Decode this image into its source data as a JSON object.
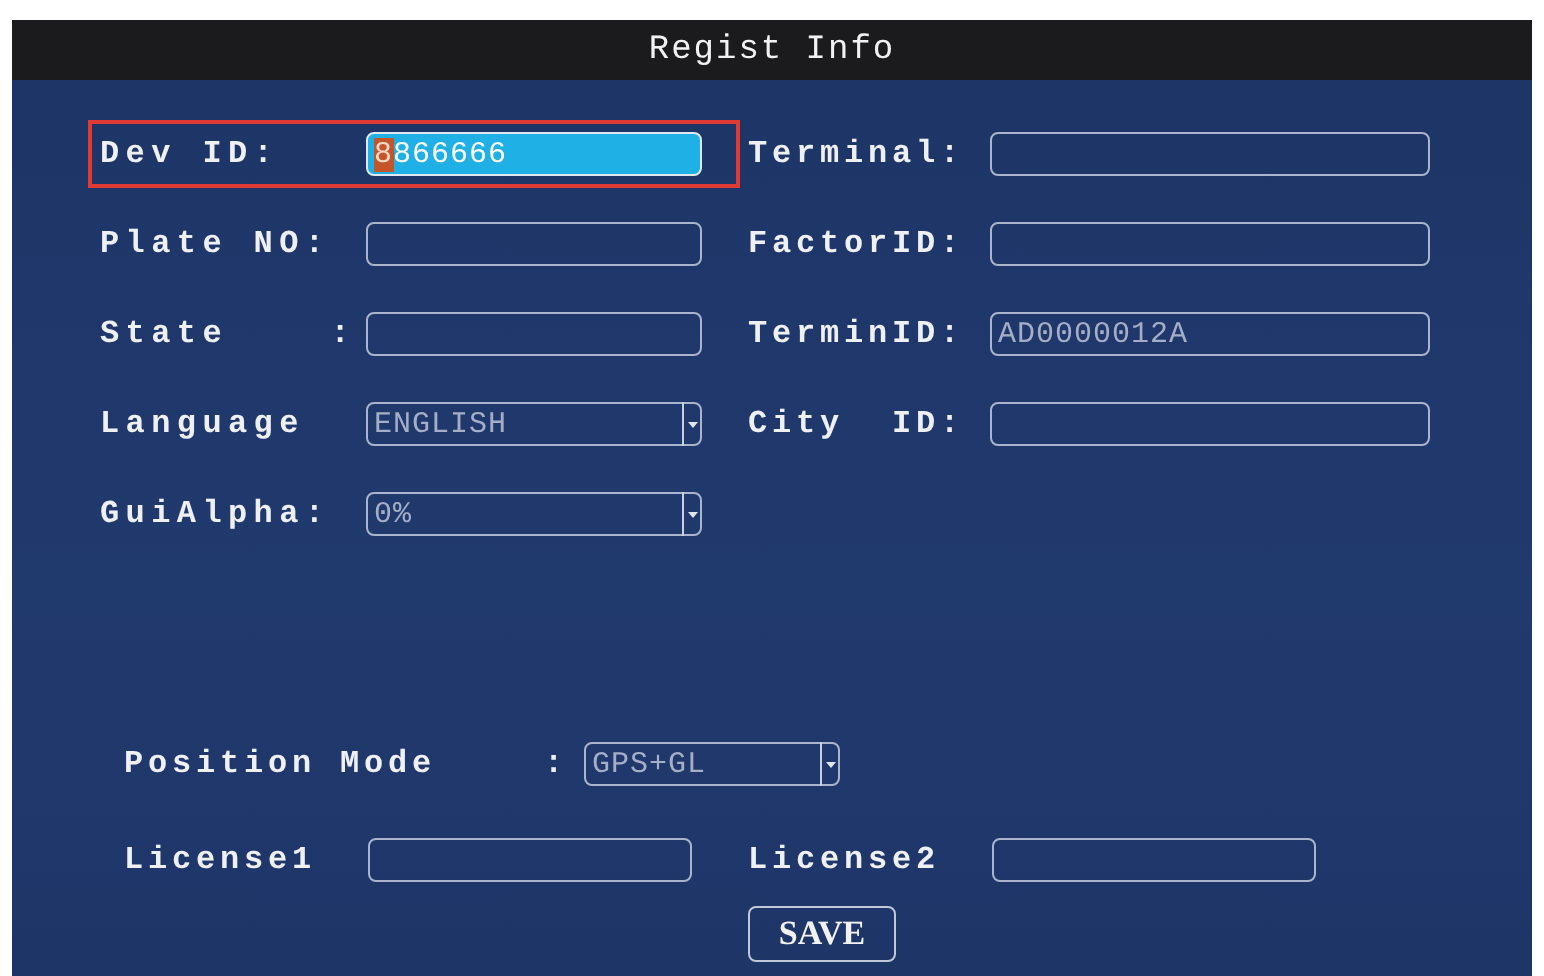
{
  "window": {
    "title": "Regist Info"
  },
  "fields": [
    {
      "label": "Dev ID:",
      "kind": "text",
      "value": "8866666",
      "focused": true
    },
    {
      "label": "Terminal:",
      "kind": "text",
      "focused": false
    },
    {
      "label": "Plate NO:",
      "kind": "text",
      "focused": false
    },
    {
      "label": "FactorID:",
      "kind": "text",
      "focused": false
    },
    {
      "label": "State    :",
      "kind": "text",
      "focused": false
    },
    {
      "label": "TerminID:",
      "kind": "text",
      "value": "AD0000012A",
      "focused": false
    },
    {
      "label": "Language",
      "kind": "dropdown",
      "value": "ENGLISH",
      "focused": false
    },
    {
      "label": "City  ID:",
      "kind": "text",
      "focused": false
    },
    {
      "label": "GuiAlpha:",
      "kind": "dropdown",
      "value": "0%",
      "focused": false
    }
  ],
  "position_mode": {
    "label": "Position Mode",
    "separator": ":",
    "value": "GPS+GL"
  },
  "licenses": [
    {
      "label": "License1"
    },
    {
      "label": "License2"
    }
  ],
  "buttons": [
    "SAVE"
  ]
}
